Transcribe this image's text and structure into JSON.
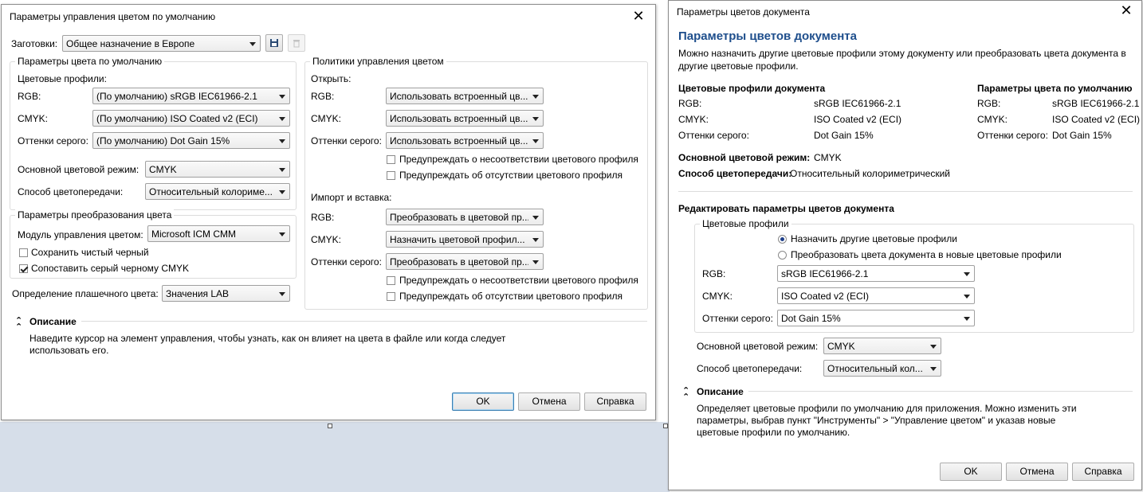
{
  "colors": {
    "heading": "#1e4e8c",
    "background_strip": "#d6dee9",
    "default_button_border": "#3c7fb1"
  },
  "left": {
    "title": "Параметры управления цветом по умолчанию",
    "preset": {
      "label": "Заготовки:",
      "value": "Общее назначение в Европе",
      "save_icon": "save-icon",
      "delete_icon": "trash-icon"
    },
    "defaults": {
      "title": "Параметры цвета по умолчанию",
      "profiles_label": "Цветовые профили:",
      "rgb_label": "RGB:",
      "rgb_value": "(По умолчанию) sRGB IEC61966-2.1",
      "cmyk_label": "CMYK:",
      "cmyk_value": "(По умолчанию) ISO Coated v2 (ECI)",
      "gray_label": "Оттенки серого:",
      "gray_value": "(По умолчанию) Dot Gain 15%",
      "mode_label": "Основной цветовой режим:",
      "mode_value": "CMYK",
      "intent_label": "Способ цветопередачи:",
      "intent_value": "Относительный колориме..."
    },
    "conversion": {
      "title": "Параметры преобразования цвета",
      "engine_label": "Модуль управления цветом:",
      "engine_value": "Microsoft ICM CMM",
      "keep_black_label": "Сохранить чистый черный",
      "keep_black_checked": false,
      "map_gray_label": "Сопоставить серый черному CMYK",
      "map_gray_checked": true
    },
    "spot": {
      "label": "Определение плашечного цвета:",
      "value": "Значения LAB"
    },
    "policies": {
      "title": "Политики управления цветом",
      "open_label": "Открыть:",
      "rgb_label": "RGB:",
      "open_rgb": "Использовать встроенный цв...",
      "cmyk_label": "CMYK:",
      "open_cmyk": "Использовать встроенный цв...",
      "gray_label": "Оттенки серого:",
      "open_gray": "Использовать встроенный цв...",
      "warn_mismatch": "Предупреждать о несоответствии цветового профиля",
      "warn_missing": "Предупреждать об отсутствии цветового профиля",
      "import_label": "Импорт и вставка:",
      "import_rgb": "Преобразовать в цветовой пр...",
      "import_cmyk": "Назначить цветовой профил...",
      "import_gray": "Преобразовать в цветовой пр..."
    },
    "description": {
      "title": "Описание",
      "text_line1": "Наведите курсор на элемент управления, чтобы узнать, как он влияет на цвета в файле или когда следует",
      "text_line2": "использовать его."
    },
    "buttons": {
      "ok": "OK",
      "cancel": "Отмена",
      "help": "Справка"
    }
  },
  "right": {
    "title": "Параметры цветов документа",
    "heading": "Параметры цветов документа",
    "intro_line1": "Можно назначить другие цветовые профили этому документу или преобразовать цвета документа в",
    "intro_line2": "другие цветовые профили.",
    "doc_profiles": {
      "title": "Цветовые профили документа",
      "rgb_label": "RGB:",
      "rgb": "sRGB IEC61966-2.1",
      "cmyk_label": "CMYK:",
      "cmyk": "ISO Coated v2 (ECI)",
      "gray_label": "Оттенки серого:",
      "gray": "Dot Gain 15%"
    },
    "default_params": {
      "title": "Параметры цвета по умолчанию",
      "rgb_label": "RGB:",
      "rgb": "sRGB IEC61966-2.1",
      "cmyk_label": "CMYK:",
      "cmyk": "ISO Coated v2 (ECI)",
      "gray_label": "Оттенки серого:",
      "gray": "Dot Gain 15%"
    },
    "main_mode": {
      "label": "Основной цветовой режим:",
      "value": "CMYK"
    },
    "intent": {
      "label": "Способ цветопередачи:",
      "value": "Относительный колориметрический"
    },
    "edit": {
      "title": "Редактировать параметры цветов документа",
      "profiles_title": "Цветовые профили",
      "assign_label": "Назначить другие цветовые профили",
      "convert_label": "Преобразовать цвета документа в новые цветовые профили",
      "rgb_label": "RGB:",
      "rgb_value": "sRGB IEC61966-2.1",
      "cmyk_label": "CMYK:",
      "cmyk_value": "ISO Coated v2 (ECI)",
      "gray_label": "Оттенки серого:",
      "gray_value": "Dot Gain 15%",
      "mode_label": "Основной цветовой режим:",
      "mode_value": "CMYK",
      "intent_label": "Способ цветопередачи:",
      "intent_value": "Относительный кол..."
    },
    "description": {
      "title": "Описание",
      "line1": "Определяет цветовые профили по умолчанию для приложения. Можно изменить эти",
      "line2": "параметры, выбрав пункт \"Инструменты\" > \"Управление цветом\" и указав новые",
      "line3": "цветовые профили по умолчанию."
    },
    "buttons": {
      "ok": "OK",
      "cancel": "Отмена",
      "help": "Справка"
    }
  }
}
